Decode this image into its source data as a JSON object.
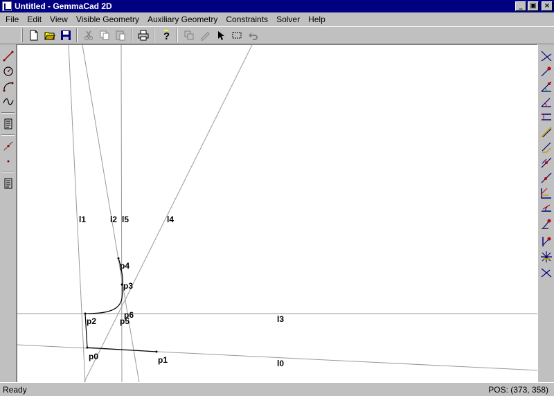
{
  "window": {
    "title": "Untitled - GemmaCad 2D",
    "controls": [
      "_",
      "▣",
      "×"
    ]
  },
  "menu": [
    {
      "label": "File"
    },
    {
      "label": "Edit"
    },
    {
      "label": "View"
    },
    {
      "label": "Visible Geometry"
    },
    {
      "label": "Auxiliary Geometry"
    },
    {
      "label": "Constraints"
    },
    {
      "label": "Solver"
    },
    {
      "label": "Help"
    }
  ],
  "toolbar": {
    "buttons": [
      "new-document-icon",
      "open-folder-icon",
      "save-disk-icon",
      "cut-icon",
      "copy-icon",
      "paste-icon",
      "print-icon",
      "help-icon",
      "copy-geometry-icon",
      "edit-pen-icon",
      "select-arrow-icon",
      "rectangle-select-icon",
      "undo-icon"
    ]
  },
  "left_tools": [
    "line-tool-icon",
    "circle-tool-icon",
    "arc-tool-icon",
    "spline-tool-icon",
    "document-tool-icon",
    "aux-line-tool-icon",
    "point-tool-icon",
    "aux-document-tool-icon"
  ],
  "right_tools": [
    "angle-constraint-icon",
    "point-on-curve-icon",
    "angle-arc-icon",
    "parallel-constraint-icon",
    "horizontal-distance-icon",
    "tangent-icon",
    "offset-icon",
    "perpendicular-icon",
    "slope-icon",
    "dimension-angle-icon",
    "horizontal-constraint-icon",
    "vertical-point-icon",
    "fix-point-icon",
    "symmetric-icon",
    "coincident-icon"
  ],
  "canvas": {
    "labels": {
      "l1": "l1",
      "l2": "l2",
      "l5": "l5",
      "l4": "l4",
      "l3": "l3",
      "l0": "l0",
      "p0": "p0",
      "p1": "p1",
      "p2": "p2",
      "p3": "p3",
      "p4": "p4",
      "p5": "p5",
      "p6": "p6"
    }
  },
  "status": {
    "left": "Ready",
    "right": "POS:  (373, 358)"
  }
}
